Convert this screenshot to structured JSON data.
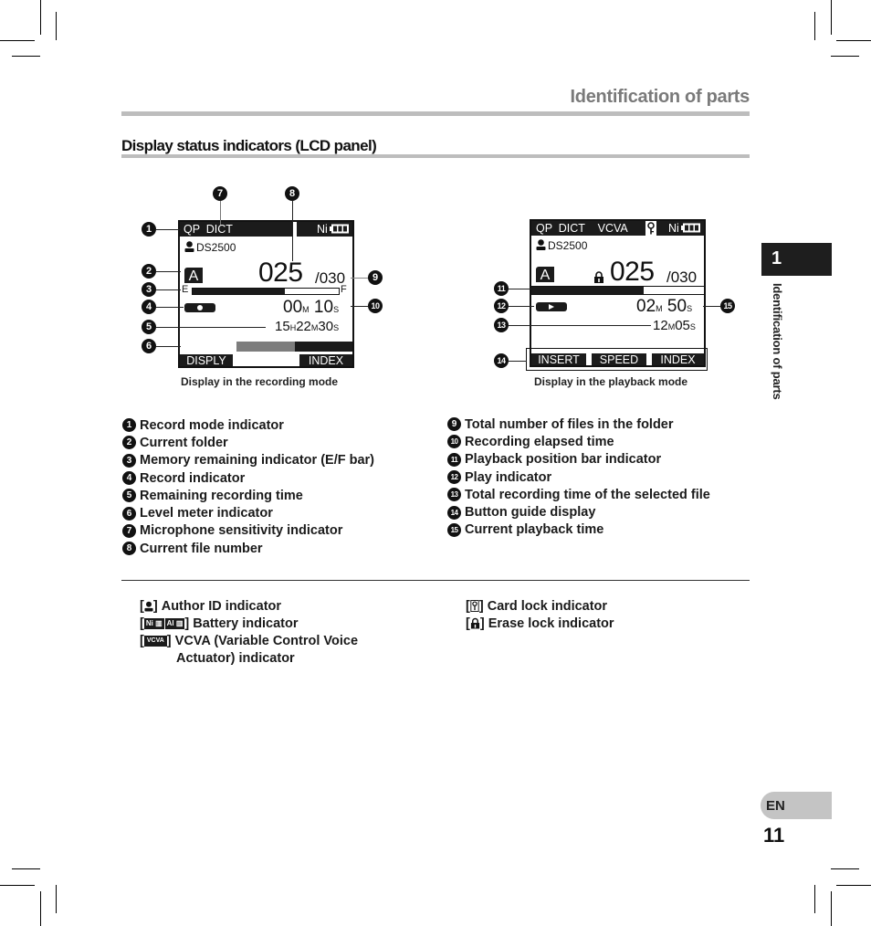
{
  "header": {
    "section_title": "Identification of parts",
    "subsection_title": "Display status indicators (LCD panel)"
  },
  "side_tab": {
    "chapter_number": "1",
    "chapter_label": "Identification of parts",
    "language": "EN",
    "page_number": "11"
  },
  "recording_display": {
    "caption": "Display in the recording mode",
    "top_left": "QP  DICT",
    "battery_label": "Ni",
    "author": "DS2500",
    "folder": "A",
    "file_number": "025",
    "total_files": "/030",
    "bar_left": "E",
    "bar_right": "F",
    "memory_used_fraction": 0.63,
    "elapsed_min": "00",
    "elapsed_min_unit": "M",
    "elapsed_sec": "10",
    "elapsed_sec_unit": "S",
    "remaining_h": "15",
    "remaining_h_unit": "H",
    "remaining_m": "22",
    "remaining_m_unit": "M",
    "remaining_s": "30",
    "remaining_s_unit": "S",
    "softkey_left": "DISPLY",
    "softkey_right": "INDEX",
    "callouts": [
      "1",
      "2",
      "3",
      "4",
      "5",
      "6",
      "7",
      "8",
      "9",
      "10"
    ]
  },
  "playback_display": {
    "caption": "Display in the playback mode",
    "top_left": "QP  DICT    VCVA",
    "battery_label": "Ni",
    "author": "DS2500",
    "folder": "A",
    "file_number": "025",
    "total_files": "/030",
    "playback_position_fraction": 0.65,
    "current_min": "02",
    "current_min_unit": "M",
    "current_sec": "50",
    "current_sec_unit": "S",
    "total_min": "12",
    "total_min_unit": "M",
    "total_sec": "05",
    "total_sec_unit": "S",
    "softkeys": [
      "INSERT",
      "SPEED",
      "INDEX"
    ],
    "callouts": [
      "11",
      "12",
      "13",
      "14",
      "15"
    ]
  },
  "legend_left": [
    {
      "num": "1",
      "label": "Record mode indicator"
    },
    {
      "num": "2",
      "label": "Current folder"
    },
    {
      "num": "3",
      "label": "Memory remaining indicator (E/F bar)"
    },
    {
      "num": "4",
      "label": "Record indicator"
    },
    {
      "num": "5",
      "label": "Remaining recording time"
    },
    {
      "num": "6",
      "label": "Level meter indicator"
    },
    {
      "num": "7",
      "label": "Microphone sensitivity indicator"
    },
    {
      "num": "8",
      "label": "Current file number"
    }
  ],
  "legend_right": [
    {
      "num": "9",
      "label": "Total number of files in the folder"
    },
    {
      "num": "10",
      "label": "Recording elapsed time"
    },
    {
      "num": "11",
      "label": "Playback position bar indicator"
    },
    {
      "num": "12",
      "label": "Play indicator"
    },
    {
      "num": "13",
      "label": "Total recording time of the selected file"
    },
    {
      "num": "14",
      "label": "Button guide display"
    },
    {
      "num": "15",
      "label": "Current playback time"
    }
  ],
  "notes_left": {
    "author_id": "Author ID indicator",
    "battery": "Battery indicator",
    "vcva_line1": "VCVA (Variable Control Voice",
    "vcva_line2": "Actuator) indicator",
    "vcva_icon_text": "VCVA",
    "battery_icon_ni": "Ni",
    "battery_icon_al": "Al",
    "bracket_open": "[",
    "bracket_close": "]"
  },
  "notes_right": {
    "card_lock": "Card lock indicator",
    "erase_lock": "Erase lock indicator"
  }
}
